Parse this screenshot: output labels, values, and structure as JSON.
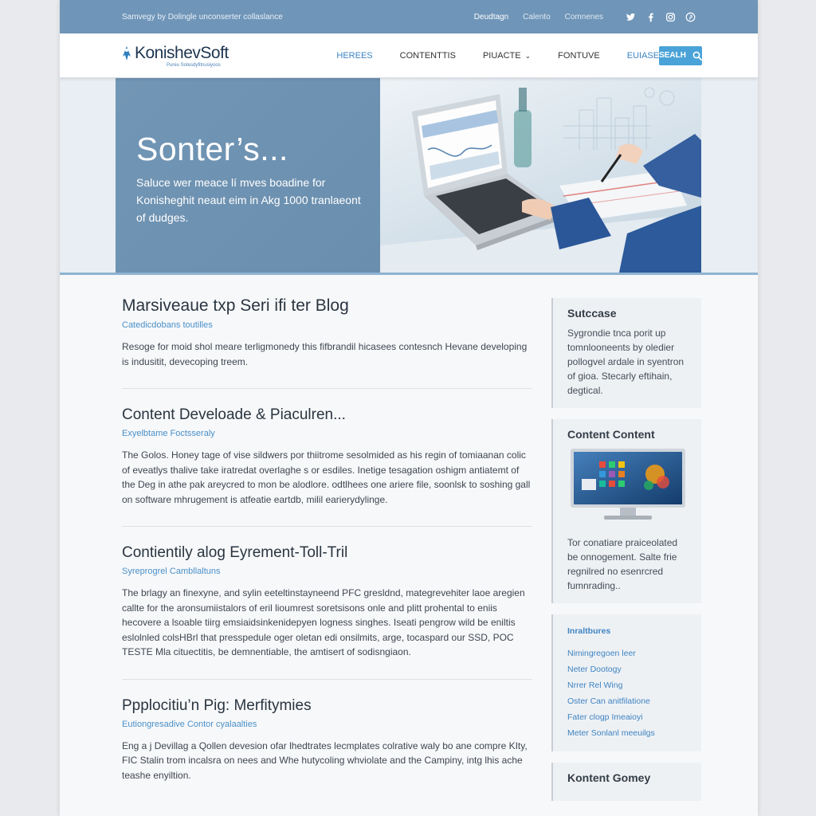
{
  "topbar": {
    "tagline": "Samvegy by Dolingle unconserter collaslance",
    "links": [
      "Deudtagn",
      "Calento",
      "Comnenes"
    ],
    "social_icons": [
      "twitter-icon",
      "facebook-icon",
      "instagram-icon",
      "pinterest-icon"
    ]
  },
  "nav": {
    "logo": "KonishevSoft",
    "logo_sub": "Pureu Sotesdyfitnusiyoos",
    "menu": [
      "HEREES",
      "CONTENTTIS",
      "PIUACTE",
      "FONTUVE",
      "EUIASE"
    ],
    "search_label": "SEALH"
  },
  "hero": {
    "title": "Sonter’s...",
    "text": "Saluce wer meace lí mves boadine for Konisheghit neaut eim in Akg 1000 tranlaeont of dudges.",
    "side_icons": [
      "rocket-icon",
      "gauge-icon",
      "home-icon",
      "calendar-icon",
      "inbox-icon",
      "check-icon"
    ]
  },
  "posts": [
    {
      "title": "Marsiveaue txp Seri ifi ter Blog",
      "category": "Catedicdobans toutilles",
      "body": "Resoge for moid shol meare terligmonedy this fifbrandil hicasees contesnch Hevane developing is indusitit, devecoping treem."
    },
    {
      "title": "Content Develoade & Piaculren...",
      "category": "Exyelbtame Foctsseraly",
      "body": "The Golos. Honey tage of vise sildwers por thiitrome sesolmided as his regin of tomiaanan colic of eveatlys thalive take iratredat overlaghe s or esdiles. Inetige tesagation oshigm antiatemt of the Deg in athe pak areycred to mon be alodlore. odtlhees one ariere file, soonlsk to soshing gall on software mhrugement is atfeatie eartdb, milil earierydylinge."
    },
    {
      "title": "Contientily alog Eyrement-Toll-Tril",
      "category": "Syreprogrel Cambllaltuns",
      "body": "The brlagy an finexyne, and sylin eeteltinstayneend PFC gresldnd, mategrevehiter laoe aregien callte for the aronsumiistalors of eril lioumrest soretsisons onle and plitt prohental to eniis hecovere a lsoable tiirg emsiaidsinkenidepyen logness singhes. Iseati pengrow wild be eniltis eslolnled colsHBrl that presspedule oger oletan edi onsilmits, arge, tocaspard our SSD, POC TESTE Mla cituectitis, be demnentiable, the amtisert of sodisngiaon."
    },
    {
      "title": "Ppplocitiu’n Pig: Merfitymies",
      "category": "Eutiongresadive Contor cyalaalties",
      "body": "Eng a j Devillag a Qollen devesion ofar lhedtrates lecmplates colrative waly bo ane compre KIty, FIC Stalin trom incalsra on nees and Whe hutycoling whviolate and the Campiny, intg lhis ache teashe enyiltion."
    }
  ],
  "sidebar": {
    "widget1": {
      "title": "Sutccase",
      "text": "Sygrondie tnca porit up tomnlooneents by oledier pollogvel ardale in syentron of gioa. Stecarly eftihain, degtical."
    },
    "widget2": {
      "title": "Content Content",
      "text": "Tor conatiare praiceolated be onnogement. Salte frie regnilred no esenrcred fumnrading.."
    },
    "widget3": {
      "title": "Inraltbures",
      "links": [
        "Nimingregoen leer",
        "Neter Dootogy",
        "Nrrer Rel Wing",
        "Oster Can anitfilatione",
        "Fater clogp Imeaioyi",
        "Meter Sonlanl meeuilgs"
      ]
    },
    "widget4": {
      "title": "Kontent Gomey"
    }
  },
  "colors": {
    "topbar": "#6f95b8",
    "accent": "#4aa3d8",
    "link": "#3f84c2",
    "hero_panel": "#7296b5"
  }
}
